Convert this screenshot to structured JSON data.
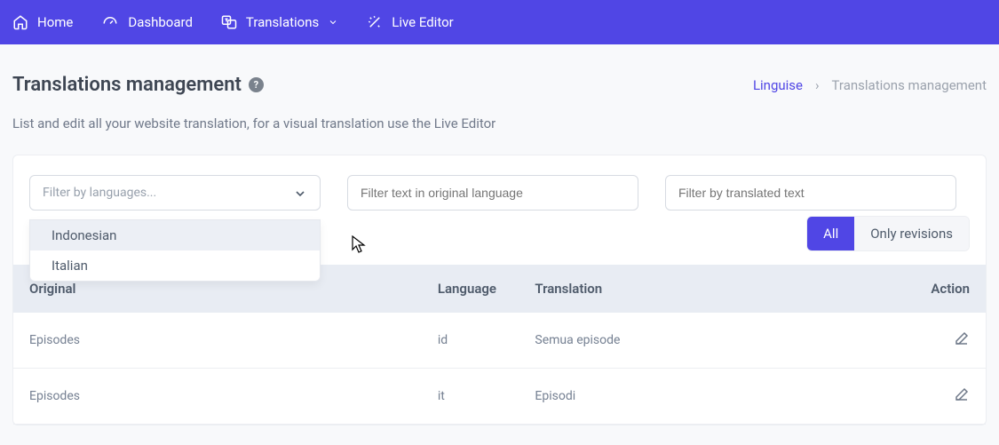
{
  "nav": {
    "home": "Home",
    "dashboard": "Dashboard",
    "translations": "Translations",
    "live_editor": "Live Editor"
  },
  "header": {
    "title": "Translations management",
    "subtitle": "List and edit all your website translation, for a visual translation use the Live Editor"
  },
  "breadcrumb": {
    "link": "Linguise",
    "sep": "›",
    "current": "Translations management"
  },
  "filters": {
    "language_placeholder": "Filter by languages...",
    "original_placeholder": "Filter text in original language",
    "translated_placeholder": "Filter by translated text"
  },
  "dropdown": {
    "items": [
      "Indonesian",
      "Italian"
    ]
  },
  "toggle": {
    "all": "All",
    "revisions": "Only revisions"
  },
  "table": {
    "headers": {
      "original": "Original",
      "language": "Language",
      "translation": "Translation",
      "action": "Action"
    },
    "rows": [
      {
        "original": "Episodes",
        "language": "id",
        "translation": "Semua episode"
      },
      {
        "original": "Episodes",
        "language": "it",
        "translation": "Episodi"
      }
    ]
  }
}
